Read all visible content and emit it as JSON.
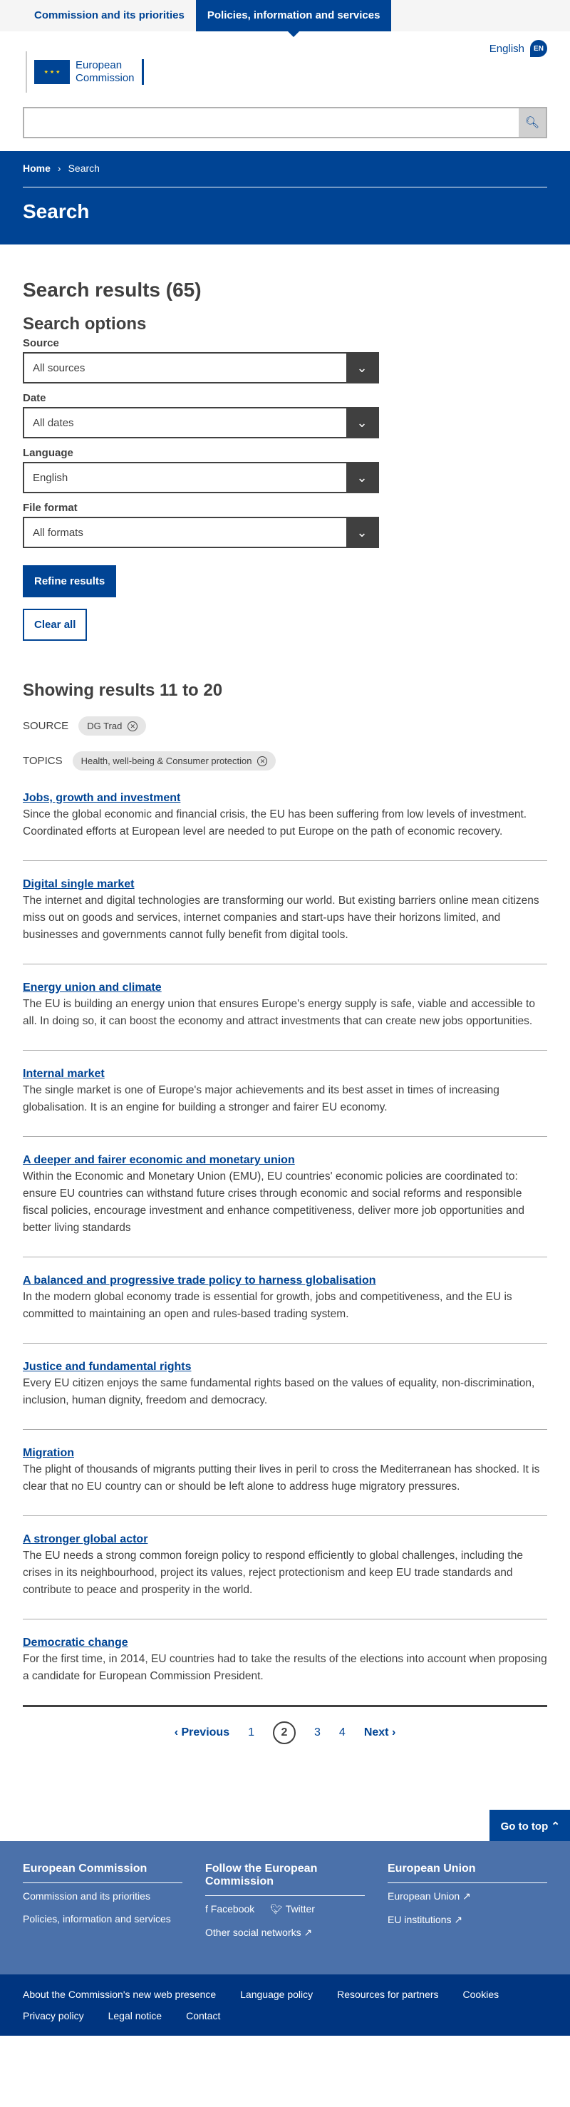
{
  "topnav": {
    "item1": "Commission and its priorities",
    "item2": "Policies, information and services"
  },
  "logo": {
    "line1": "European",
    "line2": "Commission"
  },
  "language": {
    "label": "English",
    "code": "EN"
  },
  "search": {
    "placeholder": ""
  },
  "breadcrumb": {
    "home": "Home",
    "current": "Search"
  },
  "page_title": "Search",
  "results_heading": "Search results (65)",
  "options_heading": "Search options",
  "filters": [
    {
      "label": "Source",
      "value": "All sources"
    },
    {
      "label": "Date",
      "value": "All dates"
    },
    {
      "label": "Language",
      "value": "English"
    },
    {
      "label": "File format",
      "value": "All formats"
    }
  ],
  "refine_label": "Refine results",
  "clear_label": "Clear all",
  "showing": "Showing results 11 to 20",
  "active_filters": {
    "source_label": "SOURCE",
    "source_tag": "DG Trad",
    "topics_label": "TOPICS",
    "topics_tag": "Health, well-being & Consumer protection"
  },
  "results": [
    {
      "title": "Jobs, growth and investment",
      "text": "Since the global economic and financial crisis, the EU has been suffering from low levels of investment. Coordinated efforts at European level are needed to put Europe on the path of economic recovery."
    },
    {
      "title": "Digital single market",
      "text": "The internet and digital technologies are transforming our world. But existing barriers online mean citizens miss out on goods and services, internet companies and start-ups have their horizons limited, and businesses and governments cannot fully benefit from digital tools."
    },
    {
      "title": "Energy union and climate",
      "text": "The EU is building an energy union that ensures Europe's energy supply is safe, viable and accessible to all. In doing so, it can boost the economy and attract investments that can create new jobs opportunities."
    },
    {
      "title": "Internal market",
      "text": "The single market is one of Europe's major achievements and its best asset in times of increasing globalisation. It is an engine for building a stronger and fairer EU economy."
    },
    {
      "title": "A deeper and fairer economic and monetary union",
      "text": "Within the Economic and Monetary Union (EMU), EU countries' economic policies are coordinated to: ensure EU countries can withstand future crises through economic and social reforms and responsible fiscal policies, encourage investment and enhance competitiveness, deliver more job opportunities and better living standards"
    },
    {
      "title": "A balanced and progressive trade policy to harness globalisation",
      "text": "In the modern global economy trade is essential for growth, jobs and competitiveness, and the EU is committed to maintaining an open and rules-based trading system."
    },
    {
      "title": "Justice and fundamental rights",
      "text": "Every EU citizen enjoys the same fundamental rights based on the values of equality, non-discrimination, inclusion, human dignity, freedom and democracy."
    },
    {
      "title": "Migration",
      "text": "The plight of thousands of migrants putting their lives in peril to cross the Mediterranean has shocked. It is clear that no EU country can or should be left alone to address huge migratory pressures."
    },
    {
      "title": "A stronger global actor",
      "text": "The EU needs a strong common foreign policy to respond efficiently to global challenges, including the crises in its neighbourhood, project its values, reject protectionism and keep EU trade standards and contribute to peace and prosperity in the world."
    },
    {
      "title": "Democratic change",
      "text": "For the first time, in 2014, EU countries had to take the results of the elections into account when proposing a candidate for European Commission President."
    }
  ],
  "pager": {
    "prev": "Previous",
    "p1": "1",
    "p2": "2",
    "p3": "3",
    "p4": "4",
    "next": "Next"
  },
  "gotop": "Go to top",
  "footer": {
    "col1": {
      "title": "European Commission",
      "l1": "Commission and its priorities",
      "l2": "Policies, information and services"
    },
    "col2": {
      "title": "Follow the European Commission",
      "facebook": "Facebook",
      "twitter": "Twitter",
      "other": "Other social networks"
    },
    "col3": {
      "title": "European Union",
      "l1": "European Union",
      "l2": "EU institutions"
    }
  },
  "bottom": [
    "About the Commission's new web presence",
    "Language policy",
    "Resources for partners",
    "Cookies",
    "Privacy policy",
    "Legal notice",
    "Contact"
  ]
}
